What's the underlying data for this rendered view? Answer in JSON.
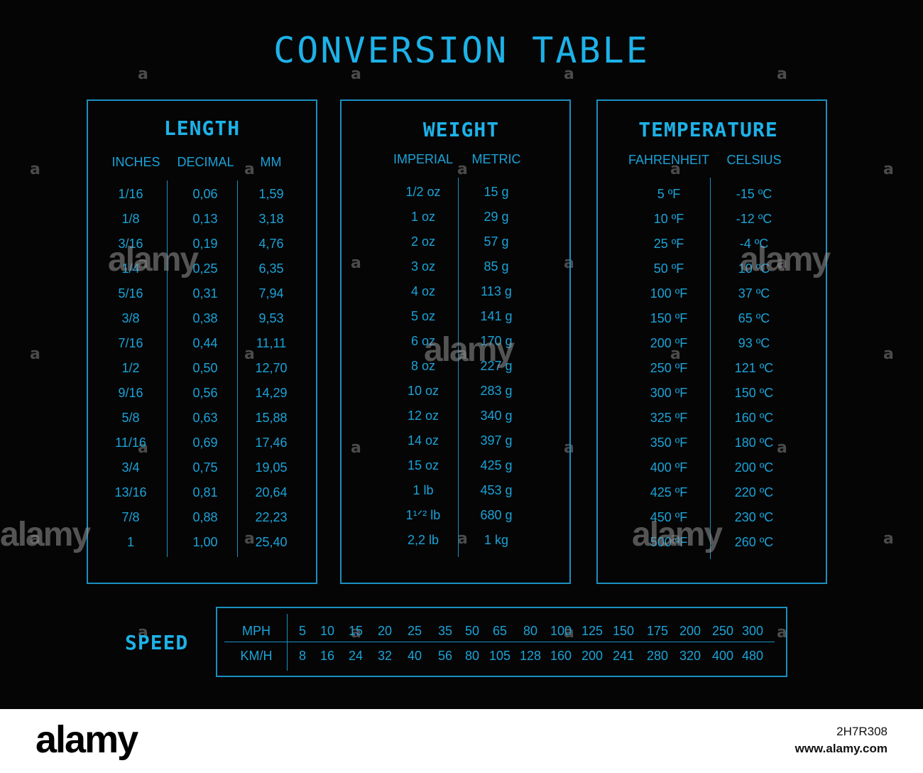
{
  "title": "CONVERSION TABLE",
  "length": {
    "title": "LENGTH",
    "headers": [
      "INCHES",
      "DECIMAL",
      "MM"
    ],
    "rows": [
      [
        "1/16",
        "0,06",
        "1,59"
      ],
      [
        "1/8",
        "0,13",
        "3,18"
      ],
      [
        "3/16",
        "0,19",
        "4,76"
      ],
      [
        "1/4",
        "0,25",
        "6,35"
      ],
      [
        "5/16",
        "0,31",
        "7,94"
      ],
      [
        "3/8",
        "0,38",
        "9,53"
      ],
      [
        "7/16",
        "0,44",
        "11,11"
      ],
      [
        "1/2",
        "0,50",
        "12,70"
      ],
      [
        "9/16",
        "0,56",
        "14,29"
      ],
      [
        "5/8",
        "0,63",
        "15,88"
      ],
      [
        "11/16",
        "0,69",
        "17,46"
      ],
      [
        "3/4",
        "0,75",
        "19,05"
      ],
      [
        "13/16",
        "0,81",
        "20,64"
      ],
      [
        "7/8",
        "0,88",
        "22,23"
      ],
      [
        "1",
        "1,00",
        "25,40"
      ]
    ]
  },
  "weight": {
    "title": "WEIGHT",
    "headers": [
      "IMPERIAL",
      "METRIC"
    ],
    "rows": [
      [
        "1/2 oz",
        "15 g"
      ],
      [
        "1 oz",
        "29 g"
      ],
      [
        "2 oz",
        "57 g"
      ],
      [
        "3 oz",
        "85 g"
      ],
      [
        "4 oz",
        "113 g"
      ],
      [
        "5 oz",
        "141 g"
      ],
      [
        "6 oz",
        "170 g"
      ],
      [
        "8 oz",
        "227 g"
      ],
      [
        "10 oz",
        "283 g"
      ],
      [
        "12 oz",
        "340 g"
      ],
      [
        "14 oz",
        "397 g"
      ],
      [
        "15 oz",
        "425 g"
      ],
      [
        "1 lb",
        "453 g"
      ],
      [
        "1¹ᐟ² lb",
        "680 g"
      ],
      [
        "2,2 lb",
        "1 kg"
      ]
    ]
  },
  "temperature": {
    "title": "TEMPERATURE",
    "headers": [
      "FAHRENHEIT",
      "CELSIUS"
    ],
    "rows": [
      [
        "5 ºF",
        "-15 ºC"
      ],
      [
        "10 ºF",
        "-12 ºC"
      ],
      [
        "25 ºF",
        "-4 ºC"
      ],
      [
        "50 ºF",
        "10 ºC"
      ],
      [
        "100 ºF",
        "37 ºC"
      ],
      [
        "150 ºF",
        "65 ºC"
      ],
      [
        "200 ºF",
        "93 ºC"
      ],
      [
        "250 ºF",
        "121 ºC"
      ],
      [
        "300 ºF",
        "150 ºC"
      ],
      [
        "325 ºF",
        "160 ºC"
      ],
      [
        "350 ºF",
        "180 ºC"
      ],
      [
        "400 ºF",
        "200 ºC"
      ],
      [
        "425 ºF",
        "220 ºC"
      ],
      [
        "450 ºF",
        "230 ºC"
      ],
      [
        "500 ºF",
        "260 ºC"
      ]
    ]
  },
  "speed": {
    "title": "SPEED",
    "mph_label": "MPH",
    "kmh_label": "KM/H",
    "mph": [
      "5",
      "10",
      "15",
      "20",
      "25",
      "35",
      "50",
      "65",
      "80",
      "100",
      "125",
      "150",
      "175",
      "200",
      "250",
      "300"
    ],
    "kmh": [
      "8",
      "16",
      "24",
      "32",
      "40",
      "56",
      "80",
      "105",
      "128",
      "160",
      "200",
      "241",
      "280",
      "320",
      "400",
      "480"
    ]
  },
  "watermark": {
    "logo": "alamy",
    "image_id": "2H7R308",
    "url": "www.alamy.com"
  },
  "colors": {
    "accent": "#1db2e8",
    "text": "#1aa3d8",
    "border": "#1a8fc0",
    "background": "#050505"
  }
}
